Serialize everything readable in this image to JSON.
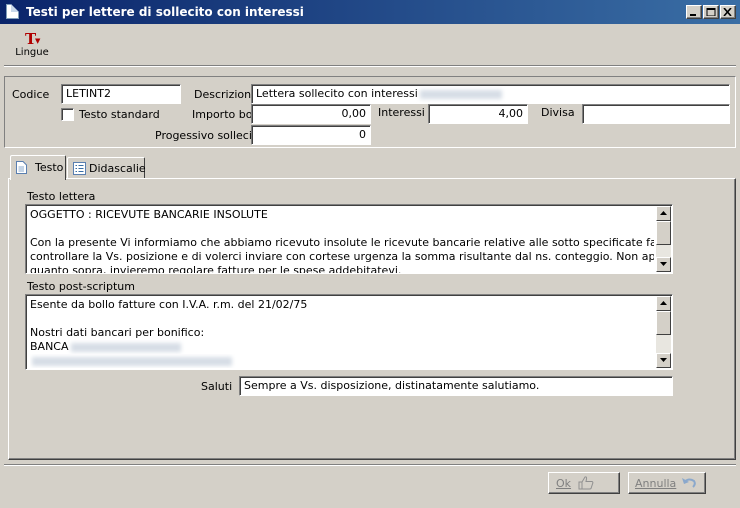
{
  "window": {
    "title": "Testi per lettere di sollecito con interessi"
  },
  "toolbar": {
    "lingue_label": "Lingue"
  },
  "form": {
    "codice_label": "Codice",
    "codice_value": "LETINT2",
    "descrizione_label": "Descrizione",
    "descrizione_value": "Lettera sollecito con interessi",
    "testo_standard_label": "Testo standard",
    "testo_standard_checked": false,
    "importo_bolli_label": "Importo bolli",
    "importo_bolli_value": "0,00",
    "interessi_label": "Interessi",
    "interessi_value": "4,00",
    "divisa_label": "Divisa",
    "divisa_value": "",
    "progressivo_label": "Progessivo sollecito",
    "progressivo_value": "0"
  },
  "tabs": [
    {
      "label": "Testo",
      "icon": "document-icon",
      "active": true
    },
    {
      "label": "Didascalie",
      "icon": "list-icon",
      "active": false
    }
  ],
  "testo_tab": {
    "testo_lettera_label": "Testo lettera",
    "testo_lettera_lines": [
      "OGGETTO : RICEVUTE BANCARIE INSOLUTE",
      "",
      "Con la presente Vi informiamo che abbiamo ricevuto insolute le ricevute bancarie relative alle sotto specificate fatture. Vi preghiamo di",
      "controllare la Vs. posizione e di volerci inviare con cortese urgenza la somma risultante dal ns. conteggio. Non appena in possesso di",
      "quanto sopra, invieremo regolare fatture per le spese addebitatevi."
    ],
    "post_scriptum_label": "Testo post-scriptum",
    "post_scriptum_lines": [
      "Esente da bollo fatture con I.V.A. r.m. del 21/02/75",
      "",
      "Nostri dati bancari per bonifico:",
      "BANCA"
    ],
    "saluti_label": "Saluti",
    "saluti_value": "Sempre a Vs. disposizione, distinatamente salutiamo."
  },
  "buttons": {
    "ok_label": "Ok",
    "annulla_label": "Annulla"
  },
  "colors": {
    "titlebar_start": "#0a246a",
    "titlebar_end": "#3a6ea5",
    "window_bg": "#d4d0c8"
  }
}
